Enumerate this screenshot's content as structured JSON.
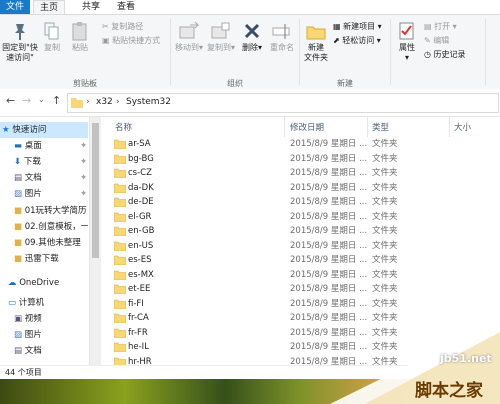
{
  "tabs": {
    "file": "文件",
    "home": "主页",
    "share": "共享",
    "view": "查看"
  },
  "ribbon": {
    "pin": "固定到\"快速访问\"",
    "copy": "复制",
    "paste": "粘贴",
    "copy_path": "复制路径",
    "paste_shortcut": "粘贴快捷方式",
    "clipboard_group": "剪贴板",
    "move_to": "移动到",
    "copy_to": "复制到",
    "delete": "删除",
    "rename": "重命名",
    "organize_group": "组织",
    "new_folder_l1": "新建",
    "new_folder_l2": "文件夹",
    "new_item": "新建项目",
    "easy_access": "轻松访问",
    "new_group": "新建",
    "properties": "属性",
    "open": "打开",
    "edit": "编辑",
    "history": "历史记录"
  },
  "address": {
    "part1": "x32",
    "part2": "System32"
  },
  "nav": {
    "quick_access": "快速访问",
    "desktop": "桌面",
    "downloads": "下载",
    "documents": "文档",
    "pictures": "图片",
    "f1": "01玩转大学简历",
    "f2": "02.创意模板，一",
    "f3": "09.其他未整理",
    "f4": "迅雷下载",
    "onedrive": "OneDrive",
    "computer": "计算机",
    "videos": "视频",
    "pictures2": "图片",
    "documents2": "文档"
  },
  "columns": {
    "name": "名称",
    "date": "修改日期",
    "type": "类型",
    "size": "大小"
  },
  "files": [
    {
      "name": "ar-SA",
      "date": "2015/8/9 星期日 ...",
      "type": "文件夹"
    },
    {
      "name": "bg-BG",
      "date": "2015/8/9 星期日 ...",
      "type": "文件夹"
    },
    {
      "name": "cs-CZ",
      "date": "2015/8/9 星期日 ...",
      "type": "文件夹"
    },
    {
      "name": "da-DK",
      "date": "2015/8/9 星期日 ...",
      "type": "文件夹"
    },
    {
      "name": "de-DE",
      "date": "2015/8/9 星期日 ...",
      "type": "文件夹"
    },
    {
      "name": "el-GR",
      "date": "2015/8/9 星期日 ...",
      "type": "文件夹"
    },
    {
      "name": "en-GB",
      "date": "2015/8/9 星期日 ...",
      "type": "文件夹"
    },
    {
      "name": "en-US",
      "date": "2015/8/9 星期日 ...",
      "type": "文件夹"
    },
    {
      "name": "es-ES",
      "date": "2015/8/9 星期日 ...",
      "type": "文件夹"
    },
    {
      "name": "es-MX",
      "date": "2015/8/9 星期日 ...",
      "type": "文件夹"
    },
    {
      "name": "et-EE",
      "date": "2015/8/9 星期日 ...",
      "type": "文件夹"
    },
    {
      "name": "fi-FI",
      "date": "2015/8/9 星期日 ...",
      "type": "文件夹"
    },
    {
      "name": "fr-CA",
      "date": "2015/8/9 星期日 ...",
      "type": "文件夹"
    },
    {
      "name": "fr-FR",
      "date": "2015/8/9 星期日 ...",
      "type": "文件夹"
    },
    {
      "name": "he-IL",
      "date": "2015/8/9 星期日 ...",
      "type": "文件夹"
    },
    {
      "name": "hr-HR",
      "date": "2015/8/9 星期日 ...",
      "type": "文件夹"
    }
  ],
  "status": {
    "count": "44 个项目"
  },
  "watermark": {
    "site": "jb51.net",
    "cn": "脚本之家"
  },
  "colors": {
    "accent": "#1979ca",
    "folder": "#f8d775",
    "selection": "#cce8ff"
  }
}
